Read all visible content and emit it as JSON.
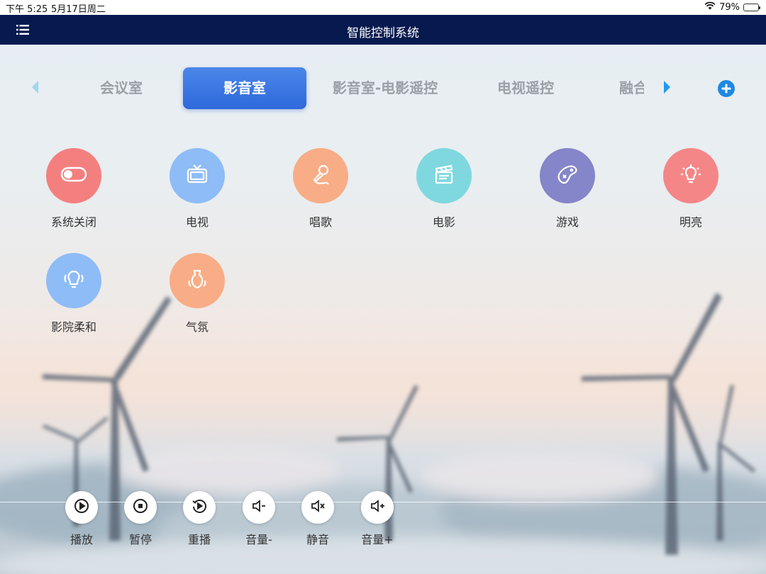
{
  "status_bar": {
    "time": "下午 5:25",
    "date": "5月17日周二",
    "battery": "79%",
    "battery_level": 0.79
  },
  "header": {
    "title": "智能控制系统"
  },
  "tabs": [
    {
      "label": "会议室",
      "active": false
    },
    {
      "label": "影音室",
      "active": true
    },
    {
      "label": "影音室-电影遥控",
      "active": false
    },
    {
      "label": "电视遥控",
      "active": false
    },
    {
      "label": "融合",
      "active": false
    }
  ],
  "scenes": [
    {
      "label": "系统关闭",
      "icon": "toggle-icon",
      "color": "#f47f7f"
    },
    {
      "label": "电视",
      "icon": "tv-icon",
      "color": "#8ebcf7"
    },
    {
      "label": "唱歌",
      "icon": "microphone-icon",
      "color": "#f8ad86"
    },
    {
      "label": "电影",
      "icon": "clapperboard-icon",
      "color": "#7fd8df"
    },
    {
      "label": "游戏",
      "icon": "gamepad-icon",
      "color": "#8585c9"
    },
    {
      "label": "明亮",
      "icon": "lightbulb-icon",
      "color": "#f58687"
    },
    {
      "label": "影院柔和",
      "icon": "soft-bulb-icon",
      "color": "#8ebcf7"
    },
    {
      "label": "气氛",
      "icon": "lamp-icon",
      "color": "#f8ad86"
    }
  ],
  "controls": [
    {
      "label": "播放",
      "icon": "play-icon"
    },
    {
      "label": "暂停",
      "icon": "stop-icon"
    },
    {
      "label": "重播",
      "icon": "replay-icon"
    },
    {
      "label": "音量-",
      "icon": "volume-down-icon"
    },
    {
      "label": "静音",
      "icon": "mute-icon"
    },
    {
      "label": "音量+",
      "icon": "volume-up-icon"
    }
  ],
  "colors": {
    "header_bg": "#071a4f",
    "active_tab": "#3a74e2",
    "accent": "#1e88e5"
  }
}
